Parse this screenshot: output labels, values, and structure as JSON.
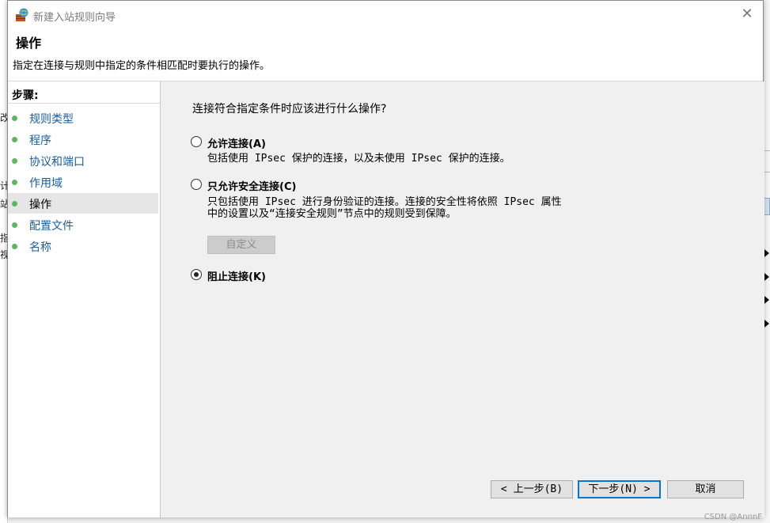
{
  "window": {
    "title": "新建入站规则向导",
    "close_symbol": "✕"
  },
  "header": {
    "title": "操作",
    "description": "指定在连接与规则中指定的条件相匹配时要执行的操作。"
  },
  "steps": {
    "title": "步骤:",
    "items": [
      {
        "label": "规则类型",
        "active": false
      },
      {
        "label": "程序",
        "active": false
      },
      {
        "label": "协议和端口",
        "active": false
      },
      {
        "label": "作用域",
        "active": false
      },
      {
        "label": "操作",
        "active": true
      },
      {
        "label": "配置文件",
        "active": false
      },
      {
        "label": "名称",
        "active": false
      }
    ]
  },
  "main": {
    "question": "连接符合指定条件时应该进行什么操作?",
    "options": [
      {
        "label": "允许连接(A)",
        "description": "包括使用 IPsec 保护的连接，以及未使用 IPsec 保护的连接。",
        "selected": false
      },
      {
        "label": "只允许安全连接(C)",
        "description": "只包括使用 IPsec 进行身份验证的连接。连接的安全性将依照 IPsec 属性\n中的设置以及“连接安全规则”节点中的规则受到保障。",
        "selected": false
      },
      {
        "label": "阻止连接(K)",
        "description": "",
        "selected": true
      }
    ],
    "customize_label": "自定义"
  },
  "footer": {
    "back_label": "< 上一步(B)",
    "next_label": "下一步(N) >",
    "cancel_label": "取消"
  },
  "background": {
    "fragments": [
      "改安",
      "计",
      "站",
      "指",
      "视"
    ]
  },
  "watermark": "CSDN @AnnnF",
  "colors": {
    "step_link": "#1a5da0",
    "step_dot": "#5cb85c",
    "default_button_border": "#0078d7"
  }
}
